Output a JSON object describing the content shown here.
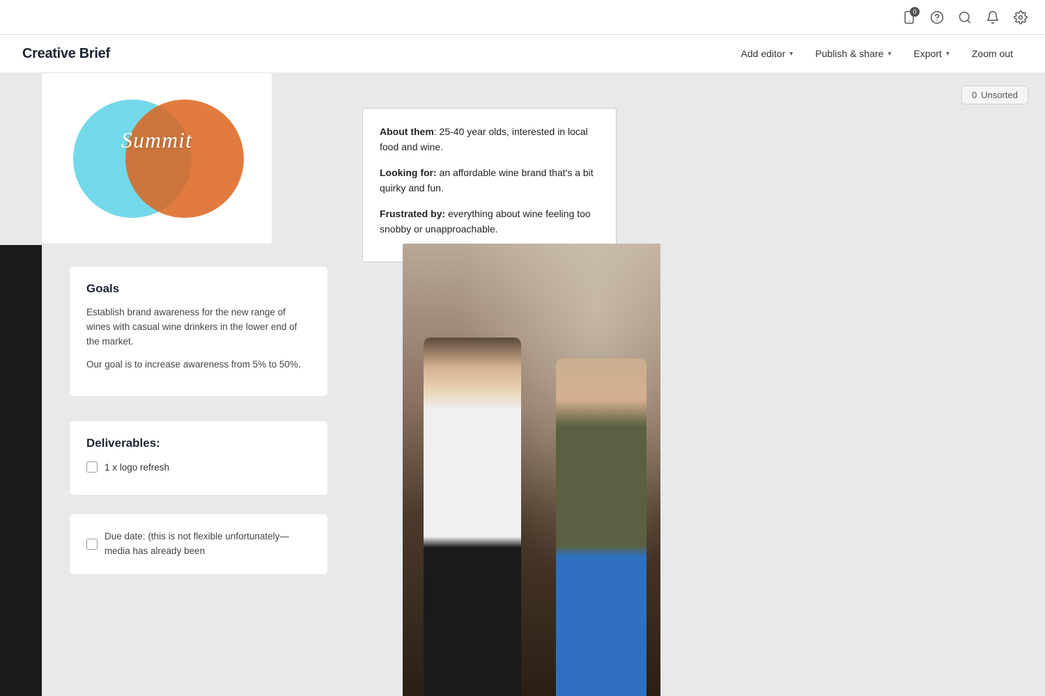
{
  "topbar": {
    "phone_badge": "0",
    "icons": [
      "phone",
      "help-circle",
      "search",
      "bell",
      "settings"
    ]
  },
  "toolbar": {
    "title": "Creative Brief",
    "add_editor_label": "Add editor",
    "publish_share_label": "Publish & share",
    "export_label": "Export",
    "zoom_out_label": "Zoom out"
  },
  "unsorted": {
    "count": "0",
    "label": "Unsorted"
  },
  "goals_card": {
    "heading": "Goals",
    "paragraph1": "Establish brand awareness for the new range of wines with casual wine drinkers in the lower end of the market.",
    "paragraph2": "Our goal is to increase awareness from 5% to 50%."
  },
  "deliverables_card": {
    "heading": "Deliverables:",
    "item1": "1 x logo refresh"
  },
  "duedate_card": {
    "label": "Due date:",
    "text": "(this is not flexible unfortunately—media has already been"
  },
  "about_card": {
    "line1_label": "About them",
    "line1_text": ": 25-40 year olds, interested in local food and wine.",
    "line2_label": "Looking for:",
    "line2_text": " an affordable wine brand that's a bit quirky and fun.",
    "line3_label": "Frustrated by:",
    "line3_text": " everything about wine feeling too snobby or unapproachable."
  },
  "logo": {
    "text": "Summit"
  }
}
